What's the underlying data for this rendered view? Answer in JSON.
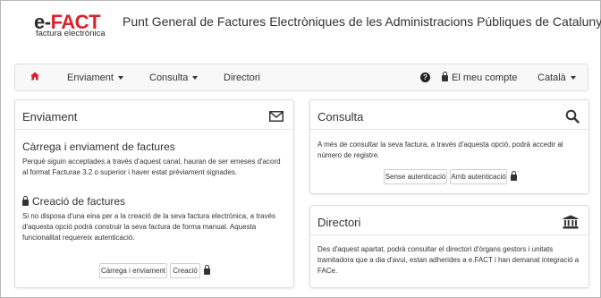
{
  "header": {
    "logo_prefix": "e-",
    "logo_main": "FACT",
    "logo_sub": "factura electrònica",
    "title": "Punt General de Factures Electròniques de les Administracions Públiques de Catalunya"
  },
  "nav": {
    "home_icon": "home-icon",
    "enviament": "Enviament",
    "consulta": "Consulta",
    "directori": "Directori",
    "help_icon": "question-circle-icon",
    "account": "El meu compte",
    "language": "Català"
  },
  "enviament_panel": {
    "title": "Enviament",
    "icon": "envelope-icon",
    "section1_title": "Càrrega i enviament de factures",
    "section1_text": "Perquè siguin acceptades a través d'aquest canal, hauran de ser emeses d'acord al format Facturae 3.2 o superior i haver estat prèviament signades.",
    "section2_title": "Creació de factures",
    "section2_text": "Si no disposa d'una eina per a la creació de la seva factura electrònica, a través d'aquesta opció podrà construir la seva factura de forma manual. Aquesta funcionalitat requereix autenticació.",
    "btn_carrega": "Càrrega i enviament",
    "btn_creacio": "Creació"
  },
  "consulta_panel": {
    "title": "Consulta",
    "icon": "search-icon",
    "text": "A més de consultar la seva factura, a través d'aquesta opció, podrà accedir al número de registre.",
    "btn_sense": "Sense autenticació",
    "btn_amb": "Amb autenticació"
  },
  "directori_panel": {
    "title": "Directori",
    "icon": "institution-icon",
    "text": "Des d'aquest apartat, podrà consultar el directori d'òrgans gestors i unitats tramitadora que a dia d'avui, estan adherides a e.FACT i han demanat integració a FACe."
  },
  "colors": {
    "brand_red": "#d9222a",
    "text": "#333333",
    "navbar_bg": "#f8f8f8"
  }
}
